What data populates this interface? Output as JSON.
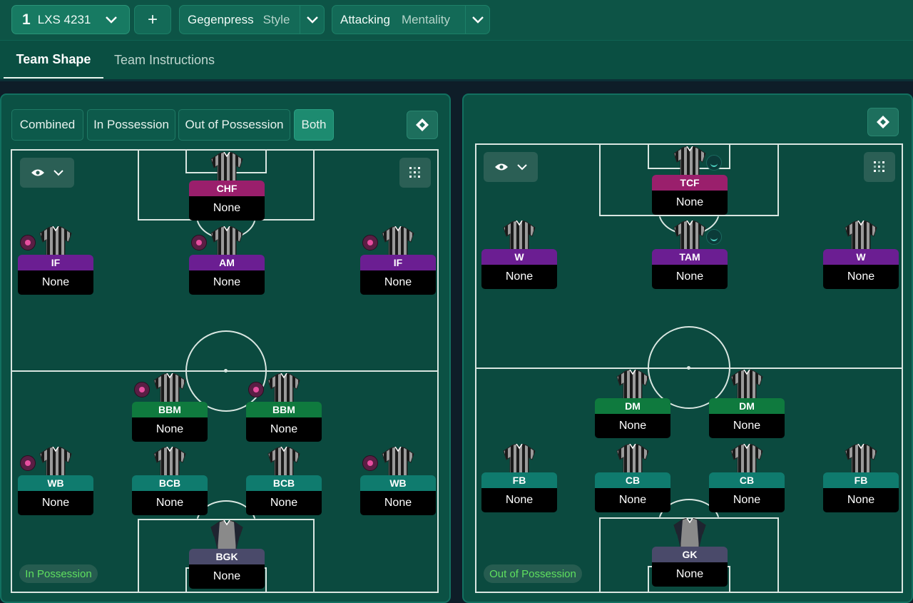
{
  "header": {
    "tactic": {
      "number": "1",
      "name": "LXS 4231"
    },
    "add_label": "+",
    "style": {
      "value": "Gegenpress",
      "label": "Style"
    },
    "mentality": {
      "value": "Attacking",
      "label": "Mentality"
    }
  },
  "tabs": [
    {
      "label": "Team Shape",
      "active": true
    },
    {
      "label": "Team Instructions",
      "active": false
    }
  ],
  "view_modes": [
    "Combined",
    "In Possession",
    "Out of Possession",
    "Both"
  ],
  "active_view_mode": "Both",
  "colors": {
    "role_attack": "#9a1f6c",
    "role_support_mid": "#6b1e92",
    "role_dm": "#0f7a3e",
    "role_defence": "#0f7b6e",
    "role_gk": "#4a4a6a",
    "phase_text": "#5fe05f"
  },
  "in_possession": {
    "phase_label": "In Possession",
    "players": [
      {
        "role": "CHF",
        "duty": "None",
        "badge": "none"
      },
      {
        "role": "IF",
        "duty": "None",
        "badge": "pink"
      },
      {
        "role": "AM",
        "duty": "None",
        "badge": "pink"
      },
      {
        "role": "IF",
        "duty": "None",
        "badge": "pink"
      },
      {
        "role": "BBM",
        "duty": "None",
        "badge": "pink"
      },
      {
        "role": "BBM",
        "duty": "None",
        "badge": "pink"
      },
      {
        "role": "WB",
        "duty": "None",
        "badge": "pink"
      },
      {
        "role": "BCB",
        "duty": "None",
        "badge": "none"
      },
      {
        "role": "BCB",
        "duty": "None",
        "badge": "none"
      },
      {
        "role": "WB",
        "duty": "None",
        "badge": "pink"
      },
      {
        "role": "BGK",
        "duty": "None",
        "badge": "none"
      }
    ]
  },
  "out_of_possession": {
    "phase_label": "Out of Possession",
    "players": [
      {
        "role": "TCF",
        "duty": "None",
        "badge": "teal"
      },
      {
        "role": "W",
        "duty": "None",
        "badge": "none"
      },
      {
        "role": "TAM",
        "duty": "None",
        "badge": "teal"
      },
      {
        "role": "W",
        "duty": "None",
        "badge": "none"
      },
      {
        "role": "DM",
        "duty": "None",
        "badge": "none"
      },
      {
        "role": "DM",
        "duty": "None",
        "badge": "none"
      },
      {
        "role": "FB",
        "duty": "None",
        "badge": "none"
      },
      {
        "role": "CB",
        "duty": "None",
        "badge": "none"
      },
      {
        "role": "CB",
        "duty": "None",
        "badge": "none"
      },
      {
        "role": "FB",
        "duty": "None",
        "badge": "none"
      },
      {
        "role": "GK",
        "duty": "None",
        "badge": "none"
      }
    ]
  }
}
